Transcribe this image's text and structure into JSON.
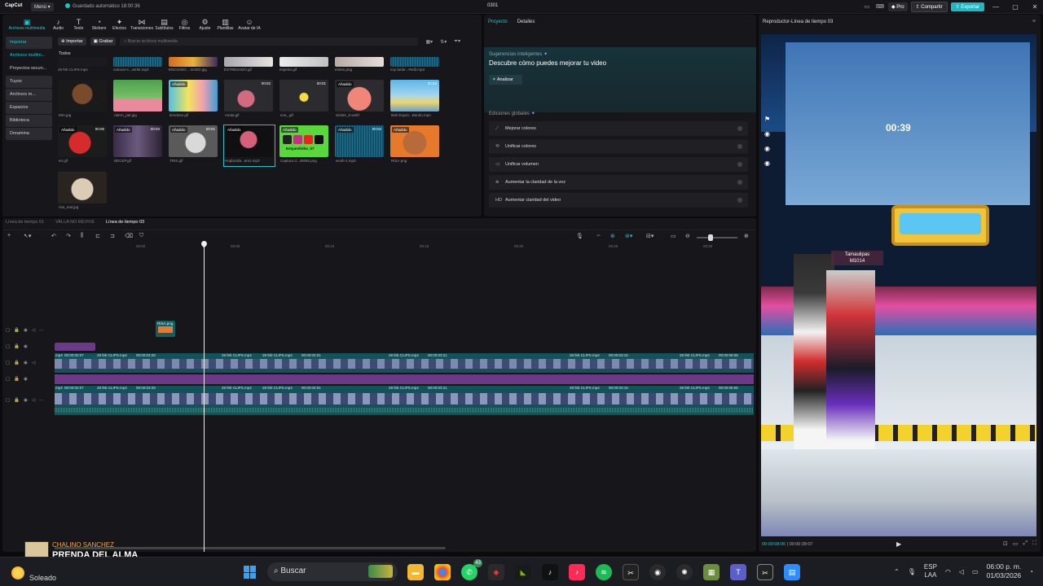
{
  "app": {
    "logo": "CapCut",
    "menu_label": "Menú",
    "autosave": "Guardado automático 18:00:36",
    "project_name": "0301",
    "pro_label": "Pro",
    "share_label": "Compartir",
    "export_label": "Exportar"
  },
  "toolbar": {
    "items": [
      "Archivos multimedia",
      "Audio",
      "Texto",
      "Stickers",
      "Efectos",
      "Transiciones",
      "Subtítulos",
      "Filtros",
      "Ajuste",
      "Plantillas",
      "Avatar de IA"
    ]
  },
  "sidebar": {
    "items": [
      "Importar",
      "Archivos multim...",
      "Proyectos secun...",
      "Tuyos",
      "Archivos m...",
      "Espacios",
      "Biblioteca",
      "Dreamina"
    ]
  },
  "media": {
    "import_label": "Importar",
    "record_label": "Grabar",
    "search_placeholder": "Buscar archivos multimedia",
    "section_label": "Todos",
    "top_strip": [
      "28 feb CLIPS.mp4",
      "cartoon-s...verlet.mp3",
      "ENOJADO ...SADO.jpg",
      "ESTRESADO.gif",
      "esperto.gif",
      "estres.png",
      "voy tarde...#edit.mp3"
    ],
    "row1": [
      {
        "name": "MIA.jpg",
        "badge": "",
        "dur": ""
      },
      {
        "name": "ratero_pat.jpg",
        "badge": "",
        "dur": ""
      },
      {
        "name": "tiendose.gif",
        "badge": "Añadido",
        "dur": ""
      },
      {
        "name": "ronda.gif",
        "badge": "",
        "dur": "00:02"
      },
      {
        "name": "eva_.gif",
        "badge": "",
        "dur": "00:01"
      },
      {
        "name": "sticker_5.webf",
        "badge": "Añadido",
        "dur": ""
      },
      {
        "name": "Bob Espon...Bando.mp4",
        "badge": "",
        "dur": "00:50"
      }
    ],
    "row2": [
      {
        "name": "en.gif",
        "badge": "Añadido",
        "dur": "00:05"
      },
      {
        "name": "DECEP.gif",
        "badge": "Añadido",
        "dur": "00:03"
      },
      {
        "name": "TRIS.gif",
        "badge": "Añadido",
        "dur": "00:01"
      },
      {
        "name": "Hoplacida...emo.mp3",
        "badge": "Añadido",
        "dur": ""
      },
      {
        "name": "Captura d...40092.png",
        "badge": "Añadido",
        "dur": ""
      },
      {
        "name": "wosh-1.mp3",
        "badge": "Añadido",
        "dur": "00:02"
      },
      {
        "name": "RISA.png",
        "badge": "Añadido",
        "dur": ""
      }
    ],
    "row3": [
      {
        "name": "risa_mal.jpg",
        "badge": "",
        "dur": ""
      }
    ],
    "social_caption": "Estyarelinho_07"
  },
  "props": {
    "tab_project": "Proyecto",
    "tab_details": "Detalles",
    "suggest_title": "Sugerencias inteligentes",
    "suggest_sub": "Descubre cómo puedes mejorar tu video",
    "analyze_label": "Analizar",
    "global_title": "Ediciones globales",
    "global_items": [
      "Mejorar colores",
      "Unificar colores",
      "Unificar volumen",
      "Aumentar la claridad de la voz",
      "Aumentar claridad del video"
    ]
  },
  "player": {
    "title": "Reproductor-Línea de tiempo 03",
    "current_time": "00:00:08:06",
    "total_time": "00:00:39:07",
    "overlay_timer": "00:39",
    "player_tag": "Tamaulipas",
    "player_id": "M1014"
  },
  "timeline": {
    "tabs": [
      "Línea de tiempo 01",
      "VALLA NO REVIVE",
      "Línea de tiempo 03"
    ],
    "ruler": [
      "00:00",
      "00:05",
      "00:10",
      "00:15",
      "00:20",
      "00:25",
      "00:30"
    ],
    "sticker_clip": "RISA.png",
    "row1_labels": [
      "mp4",
      "00:00:02:07",
      "28 feb CLIPS.mp4",
      "00:00:03:28",
      "28 feb CLIPS.mp4",
      "28 feb CLIPS.mp4",
      "00:00:04:01",
      "28 feb CLIPS.mp4",
      "00:00:03:21",
      "28 feb CLIPS.mp4",
      "00:00:03:16",
      "28 feb CLIPS.mp4",
      "00:00:05:06"
    ],
    "row2_labels": [
      "mp4",
      "00:00:02:07",
      "28 feb CLIPS.mp4",
      "00:00:03:28",
      "28 feb CLIPS.mp4",
      "28 feb CLIPS.mp4",
      "00:00:04:01",
      "28 feb CLIPS.mp4",
      "00:00:03:21",
      "28 feb CLIPS.mp4",
      "00:00:03:16",
      "28 feb CLIPS.mp4",
      "00:00:05:06"
    ]
  },
  "music": {
    "artist": "CHALINO SANCHEZ",
    "song": "PRENDA DEL ALMA"
  },
  "taskbar": {
    "weather": "Soleado",
    "search": "Buscar",
    "whatsapp_badge": "43",
    "lang_top": "ESP",
    "lang_bottom": "LAA",
    "time": "06:00 p. m.",
    "date": "01/03/2026"
  }
}
